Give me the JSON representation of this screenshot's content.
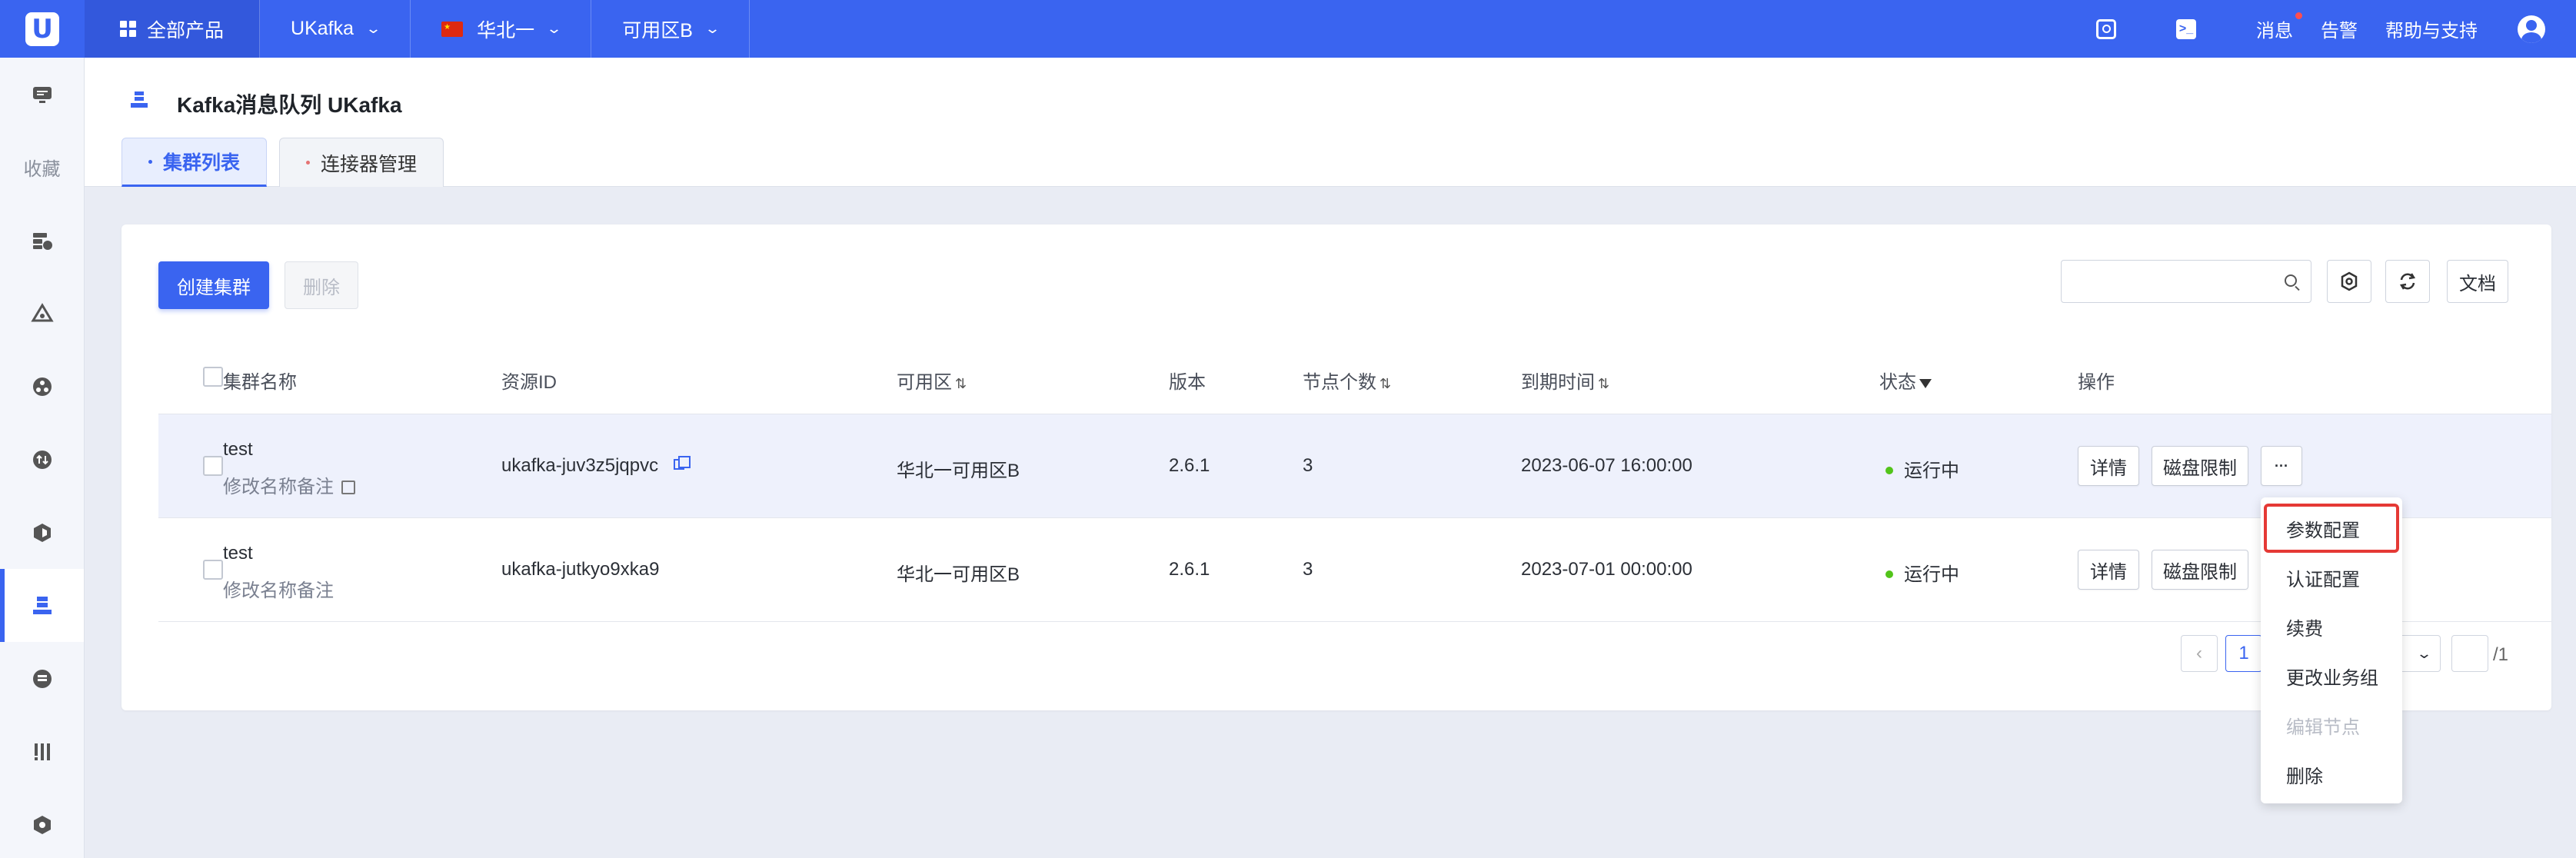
{
  "topbar": {
    "logo": "U",
    "all_products": "全部产品",
    "product": "UKafka",
    "region": "华北一",
    "zone": "可用区B",
    "messages": "消息",
    "alerts": "告警",
    "help": "帮助与支持"
  },
  "sidebar": {
    "favorites": "收藏"
  },
  "header": {
    "title": "Kafka消息队列 UKafka",
    "tabs": [
      {
        "label": "集群列表"
      },
      {
        "label": "连接器管理"
      }
    ]
  },
  "toolbar": {
    "create": "创建集群",
    "delete": "删除",
    "search_placeholder": "",
    "docs": "文档"
  },
  "table": {
    "headers": {
      "name": "集群名称",
      "resource_id": "资源ID",
      "zone": "可用区",
      "version": "版本",
      "nodes": "节点个数",
      "expire": "到期时间",
      "status": "状态",
      "ops": "操作"
    },
    "rows": [
      {
        "name": "test",
        "remark": "修改名称备注",
        "resource_id": "ukafka-juv3z5jqpvc",
        "zone": "华北一可用区B",
        "version": "2.6.1",
        "nodes": "3",
        "expire": "2023-06-07 16:00:00",
        "status": "运行中"
      },
      {
        "name": "test",
        "remark": "修改名称备注",
        "resource_id": "ukafka-jutkyo9xka9",
        "zone": "华北一可用区B",
        "version": "2.6.1",
        "nodes": "3",
        "expire": "2023-07-01 00:00:00",
        "status": "运行中"
      }
    ],
    "op_detail": "详情",
    "op_disk": "磁盘限制",
    "op_more": "···"
  },
  "pagination": {
    "prev": "‹",
    "current": "1",
    "total": "/1"
  },
  "dropdown": {
    "items": [
      {
        "label": "参数配置"
      },
      {
        "label": "认证配置"
      },
      {
        "label": "续费"
      },
      {
        "label": "更改业务组"
      },
      {
        "label": "编辑节点"
      },
      {
        "label": "删除"
      }
    ]
  },
  "colors": {
    "brand": "#3a64f0",
    "status_ok": "#52c41a",
    "highlight": "#e53935"
  }
}
